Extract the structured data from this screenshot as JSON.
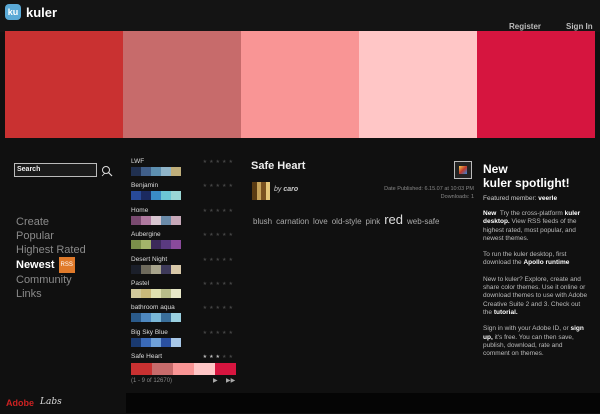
{
  "header": {
    "logo_text": "ku",
    "brand": "kuler",
    "register": "Register",
    "sign_in": "Sign In"
  },
  "featured_swatches": [
    "#c93131",
    "#c76b6b",
    "#f99595",
    "#ffc6c6",
    "#d6153f"
  ],
  "search": {
    "label": "Search"
  },
  "nav": {
    "items": [
      "Create",
      "Popular",
      "Highest Rated",
      "Newest",
      "Community",
      "Links"
    ],
    "active": "Newest",
    "rss_badge": "RSS"
  },
  "themes": [
    {
      "name": "LWF",
      "rating": 0,
      "colors": [
        "#203050",
        "#405f8a",
        "#5d8fb0",
        "#8fb4c8",
        "#bfae7a"
      ]
    },
    {
      "name": "Benjamin",
      "rating": 0,
      "colors": [
        "#284a98",
        "#1b2a60",
        "#3a8cc6",
        "#6cc7d5",
        "#9ad7d5"
      ]
    },
    {
      "name": "Home",
      "rating": 0,
      "colors": [
        "#7a4a70",
        "#b07aa0",
        "#d8c6d0",
        "#6a8aa8",
        "#c7a9b9"
      ]
    },
    {
      "name": "Aubergine",
      "rating": 0,
      "colors": [
        "#7b8f4a",
        "#a3b46a",
        "#3c2a5a",
        "#5a3a80",
        "#8a4a9b"
      ]
    },
    {
      "name": "Desert Night",
      "rating": 0,
      "colors": [
        "#1b1f2a",
        "#6e6a5c",
        "#a8a48c",
        "#3e3a5a",
        "#d8c8a8"
      ]
    },
    {
      "name": "Pastel",
      "rating": 0,
      "colors": [
        "#d0c89a",
        "#c8b87a",
        "#dfe0b0",
        "#b8bd8a",
        "#e8e8c8"
      ]
    },
    {
      "name": "bathroom aqua",
      "rating": 0,
      "colors": [
        "#2a5a8a",
        "#4e88c0",
        "#7ab8d8",
        "#3a6f9a",
        "#9ad0e0"
      ]
    },
    {
      "name": "Big Sky Blue",
      "rating": 0,
      "colors": [
        "#1a3a70",
        "#3a6ab8",
        "#6fa0d8",
        "#2a50a0",
        "#a8c8e8"
      ]
    },
    {
      "name": "Safe Heart",
      "rating": 3,
      "colors": [
        "#c93131",
        "#c76b6b",
        "#f99595",
        "#ffc6c6",
        "#d6153f"
      ]
    }
  ],
  "stars_glyph": "★★★★★",
  "pager": {
    "text": "(1 - 9 of 12670)",
    "next": "▶",
    "last": "▶▶"
  },
  "detail": {
    "title": "Safe Heart",
    "by": "by",
    "author": "caro",
    "date_published": "Date Published: 6.15.07 at 10:03 PM",
    "downloads": "Downloads: 1",
    "tags": [
      "blush",
      "carnation",
      "love",
      "old-style",
      "pink",
      "red",
      "web-safe"
    ],
    "big_tag": "red"
  },
  "spotlight": {
    "title_line1": "New",
    "title_line2": "kuler spotlight!",
    "featured_label": "Featured member:",
    "featured_name": "veerle",
    "para1_bold": "New",
    "para1": "Try the cross-platform",
    "para1_bold2": "kuler desktop.",
    "para1_rest": "View RSS feeds of the highest rated, most popular, and newest themes.",
    "para2": "To run the kuler desktop, first download the",
    "para2_bold": "Apollo runtime",
    "para3": "New to kuler? Explore, create and share color themes. Use it online or download themes to use with Adobe Creative Suite 2 and 3. Check out the",
    "para3_bold": "tutorial.",
    "para4": "Sign in with your Adobe ID, or",
    "para4_bold": "sign up,",
    "para4_rest": "it's free. You can then save, publish, download, rate and comment on themes."
  },
  "footer": {
    "adobe": "Adobe",
    "labs": "Labs"
  }
}
